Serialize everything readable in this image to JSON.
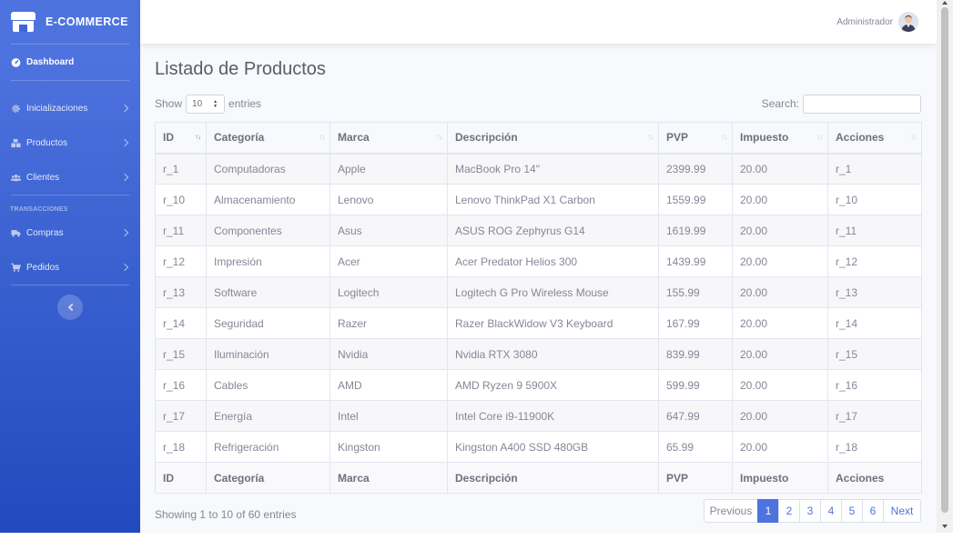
{
  "brand": {
    "name": "E-COMMERCE",
    "icon": "store-icon"
  },
  "sidebar": {
    "dashboard": {
      "label": "Dashboard",
      "icon": "tachometer-icon"
    },
    "items": [
      {
        "label": "Inicializaciones",
        "icon": "cog-icon"
      },
      {
        "label": "Productos",
        "icon": "boxes-icon"
      },
      {
        "label": "Clientes",
        "icon": "users-icon"
      }
    ],
    "heading": "TRANSACCIONES",
    "transactions": [
      {
        "label": "Compras",
        "icon": "truck-icon"
      },
      {
        "label": "Pedidos",
        "icon": "cart-icon"
      }
    ]
  },
  "topbar": {
    "user_name": "Administrador"
  },
  "page": {
    "title": "Listado de Productos"
  },
  "controls": {
    "show_label": "Show",
    "entries_label": "entries",
    "page_length": "10",
    "search_label": "Search:",
    "search_value": ""
  },
  "table": {
    "columns": [
      "ID",
      "Categoría",
      "Marca",
      "Descripción",
      "PVP",
      "Impuesto",
      "Acciones"
    ],
    "rows": [
      [
        "r_1",
        "Computadoras",
        "Apple",
        "MacBook Pro 14\"",
        "2399.99",
        "20.00",
        "r_1"
      ],
      [
        "r_10",
        "Almacenamiento",
        "Lenovo",
        "Lenovo ThinkPad X1 Carbon",
        "1559.99",
        "20.00",
        "r_10"
      ],
      [
        "r_11",
        "Componentes",
        "Asus",
        "ASUS ROG Zephyrus G14",
        "1619.99",
        "20.00",
        "r_11"
      ],
      [
        "r_12",
        "Impresión",
        "Acer",
        "Acer Predator Helios 300",
        "1439.99",
        "20.00",
        "r_12"
      ],
      [
        "r_13",
        "Software",
        "Logitech",
        "Logitech G Pro Wireless Mouse",
        "155.99",
        "20.00",
        "r_13"
      ],
      [
        "r_14",
        "Seguridad",
        "Razer",
        "Razer BlackWidow V3 Keyboard",
        "167.99",
        "20.00",
        "r_14"
      ],
      [
        "r_15",
        "Iluminación",
        "Nvidia",
        "Nvidia RTX 3080",
        "839.99",
        "20.00",
        "r_15"
      ],
      [
        "r_16",
        "Cables",
        "AMD",
        "AMD Ryzen 9 5900X",
        "599.99",
        "20.00",
        "r_16"
      ],
      [
        "r_17",
        "Energía",
        "Intel",
        "Intel Core i9-11900K",
        "647.99",
        "20.00",
        "r_17"
      ],
      [
        "r_18",
        "Refrigeración",
        "Kingston",
        "Kingston A400 SSD 480GB",
        "65.99",
        "20.00",
        "r_18"
      ]
    ]
  },
  "footer": {
    "info": "Showing 1 to 10 of 60 entries",
    "previous": "Previous",
    "next": "Next",
    "pages": [
      "1",
      "2",
      "3",
      "4",
      "5",
      "6"
    ],
    "current_page": "1"
  },
  "colors": {
    "primary": "#4e73df",
    "sidebar_dark": "#224abe"
  }
}
